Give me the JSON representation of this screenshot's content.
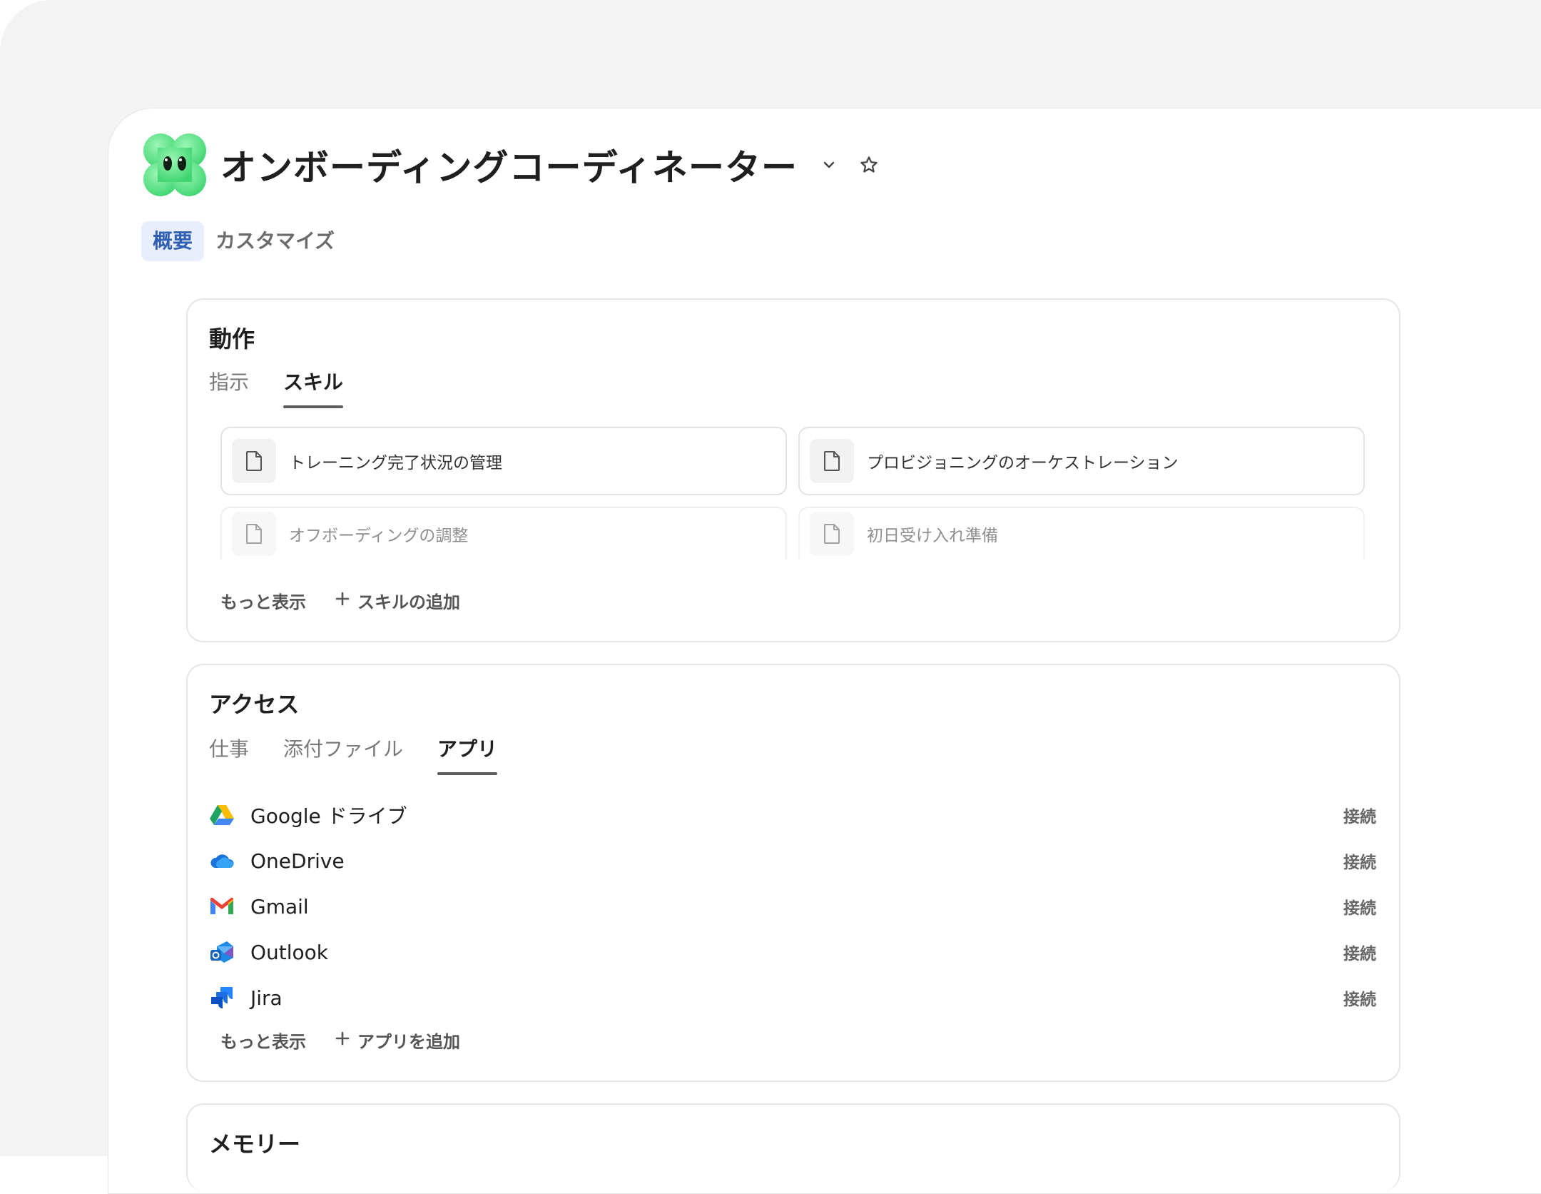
{
  "header": {
    "title": "オンボーディングコーディネーター",
    "logo_icon": "green-clover-mascot",
    "dropdown_icon": "chevron-down-icon",
    "favorite_icon": "star-icon"
  },
  "top_tabs": [
    {
      "label": "概要",
      "active": true
    },
    {
      "label": "カスタマイズ",
      "active": false
    }
  ],
  "behavior": {
    "title": "動作",
    "tabs": [
      {
        "label": "指示",
        "active": false
      },
      {
        "label": "スキル",
        "active": true
      }
    ],
    "skills": [
      {
        "label": "トレーニング完了状況の管理"
      },
      {
        "label": "プロビジョニングのオーケストレーション"
      },
      {
        "label": "オフボーディングの調整"
      },
      {
        "label": "初日受け入れ準備"
      }
    ],
    "show_more": "もっと表示",
    "add": "スキルの追加"
  },
  "access": {
    "title": "アクセス",
    "tabs": [
      {
        "label": "仕事",
        "active": false
      },
      {
        "label": "添付ファイル",
        "active": false
      },
      {
        "label": "アプリ",
        "active": true
      }
    ],
    "apps": [
      {
        "name": "Google ドライブ",
        "icon": "google-drive-icon",
        "action": "接続"
      },
      {
        "name": "OneDrive",
        "icon": "onedrive-icon",
        "action": "接続"
      },
      {
        "name": "Gmail",
        "icon": "gmail-icon",
        "action": "接続"
      },
      {
        "name": "Outlook",
        "icon": "outlook-icon",
        "action": "接続"
      },
      {
        "name": "Jira",
        "icon": "jira-icon",
        "action": "接続"
      }
    ],
    "show_more": "もっと表示",
    "add": "アプリを追加"
  },
  "memory": {
    "title": "メモリー"
  },
  "colors": {
    "active_tab_bg": "#e8eefb",
    "active_tab_text": "#2f5fb3",
    "mascot_green": "#5be38a"
  }
}
